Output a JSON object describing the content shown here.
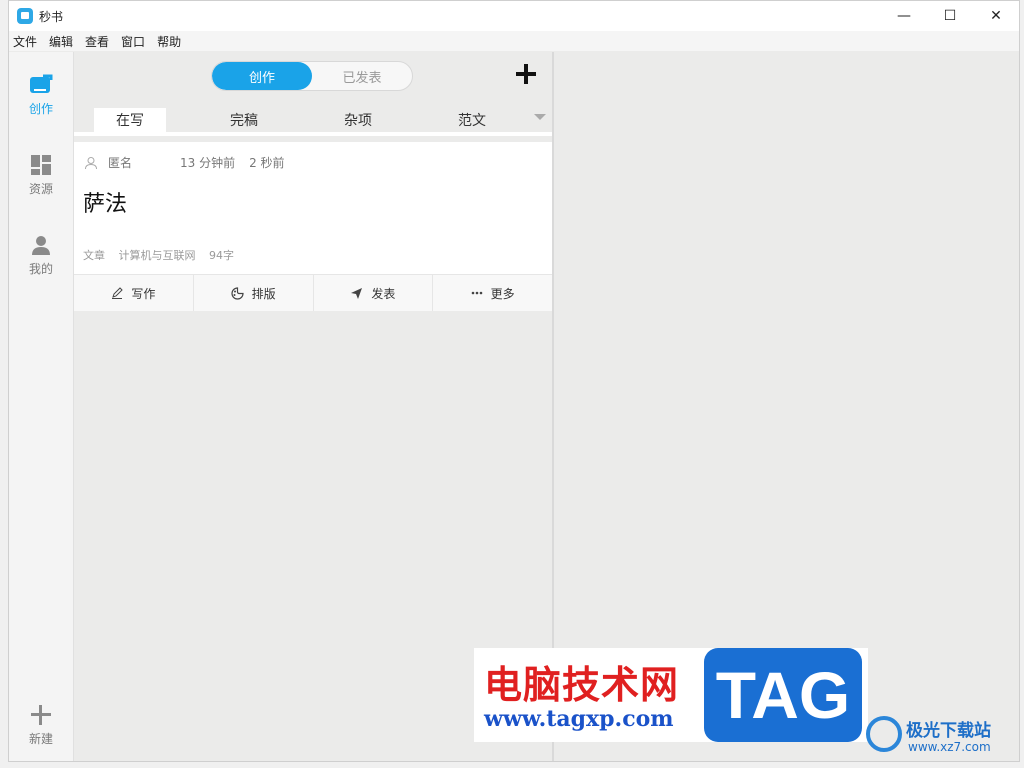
{
  "app": {
    "title": "秒书"
  },
  "window_controls": {
    "minimize": "—",
    "maximize": "☐",
    "close": "✕"
  },
  "menu": [
    "文件",
    "编辑",
    "查看",
    "窗口",
    "帮助"
  ],
  "nav": {
    "items": [
      "创作",
      "资源",
      "我的"
    ],
    "new_label": "新建"
  },
  "toggle": {
    "create": "创作",
    "published": "已发表"
  },
  "subtabs": [
    "在写",
    "完稿",
    "杂项",
    "范文"
  ],
  "card": {
    "author": "匿名",
    "time_created": "13 分钟前",
    "time_updated": "2 秒前",
    "title": "萨法",
    "type": "文章",
    "category": "计算机与互联网",
    "word_count": "94字"
  },
  "actions": [
    "写作",
    "排版",
    "发表",
    "更多"
  ],
  "watermark": {
    "site_cn": "电脑技术网",
    "site_url": "www.tagxp.com",
    "badge": "TAG",
    "site2_cn": "极光下载站",
    "site2_url": "www.xz7.com"
  },
  "colors": {
    "accent": "#1aa3e8"
  }
}
